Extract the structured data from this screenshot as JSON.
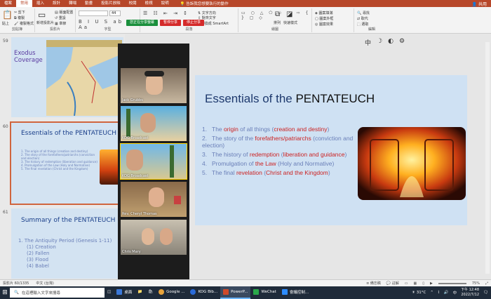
{
  "tabs": [
    "檔案",
    "常用",
    "插入",
    "設計",
    "轉場",
    "動畫",
    "投影片放映",
    "校閱",
    "檢視",
    "說明"
  ],
  "active_tab": 1,
  "tell_me": "告訴我您想要執行的動作",
  "share_label": "共用",
  "ribbon": {
    "clipboard": {
      "label": "剪貼簿",
      "paste": "貼上",
      "cut": "剪下",
      "copy": "複製",
      "format_painter": "複製格式"
    },
    "slides": {
      "label": "投影片",
      "new_slide": "新增投影片",
      "layout": "版面配置",
      "reset": "重設",
      "section": "章節"
    },
    "font": {
      "label": "字型",
      "font_name": "",
      "font_size": "44"
    },
    "paragraph": {
      "label": "段落",
      "text_direction": "文字方向",
      "align_text": "對齊文字",
      "smartart": "轉換成 SmartArt"
    },
    "drawing": {
      "label": "繪圖",
      "arrange": "排列",
      "quick_styles": "快速樣式",
      "shape_fill": "圖案填滿",
      "shape_outline": "圖案外框",
      "shape_effects": "圖案效果"
    },
    "editing": {
      "label": "編輯",
      "find": "尋找",
      "replace": "取代",
      "select": "選取"
    }
  },
  "zoom_bar": {
    "screen_share": "您正在分享螢幕",
    "pause": "暫停分享",
    "stop": "停止分享"
  },
  "slides": [
    {
      "num": "59",
      "title": "Exodus Coverage"
    },
    {
      "num": "60",
      "title": "Essentials of the PENTATEUCH"
    },
    {
      "num": "61",
      "title": "Summary of the PENTATEUCH"
    }
  ],
  "thumb60_items": [
    "1.  The origin of all things (creation and destiny)",
    "2.  The story of the forefathers/patriarchs (conviction and election)",
    "3.  The history of redemption (liberation and guidance)",
    "4.  Promulgation of the Law (Holy and Normative)",
    "5.  The final revelation (Christ and the Kingdom)"
  ],
  "thumb61_items": [
    "1. The Antiquity Period (Genesis 1-11)",
    "(1) Creation",
    "(2) Fallen",
    "(3) Flood",
    "(4) Babel"
  ],
  "participants": [
    "Jack Grubbs",
    "KOG Broadcast",
    "KOG Broadcast",
    "Rev. Cheryl Thomas",
    "Chris Mary"
  ],
  "main": {
    "title_prefix": "Essentials of the ",
    "title_bold": "PENTATEUCH",
    "items": [
      {
        "n": "1.",
        "pre": "The ",
        "hl": "origin",
        "mid": " of all things (",
        "hl2": "creation and destiny",
        "post": ")"
      },
      {
        "n": "2.",
        "pre": "The story of the ",
        "hl": "forefathers/patriarchs",
        "mid": " (conviction and election)",
        "hl2": "",
        "post": ""
      },
      {
        "n": "3.",
        "pre": "The history of ",
        "hl": "redemption",
        "mid": " (",
        "hl2": "liberation and guidance",
        "post": ")"
      },
      {
        "n": "4.",
        "pre": "Promulgation of ",
        "hl": "the Law",
        "mid": " (Holy and Normative)",
        "hl2": "",
        "post": ""
      },
      {
        "n": "5.",
        "pre": "The final ",
        "hl": "revelation",
        "mid": " (",
        "hl2": "Christ and the Kingdom",
        "post": ")"
      }
    ]
  },
  "status": {
    "slide": "投影片 60/1335",
    "language": "中文 (台灣)",
    "notes": "備忘稿",
    "comments": "註解",
    "zoom": "75%"
  },
  "taskbar": {
    "search_placeholder": "在這裡輸入文字來搜尋",
    "apps": [
      {
        "label": "桌面",
        "color": "#3b78d8"
      },
      {
        "label": "Google ...",
        "color": "#e8a33b"
      },
      {
        "label": "KOG Bib...",
        "color": "#2a6ad8"
      },
      {
        "label": "PowerP...",
        "color": "#d04a2a"
      },
      {
        "label": "WeChat",
        "color": "#2aa84a"
      },
      {
        "label": "會議控制...",
        "color": "#2d8cff"
      }
    ],
    "weather": "31°C",
    "time": "下午 12:48",
    "date": "2022/7/12"
  }
}
